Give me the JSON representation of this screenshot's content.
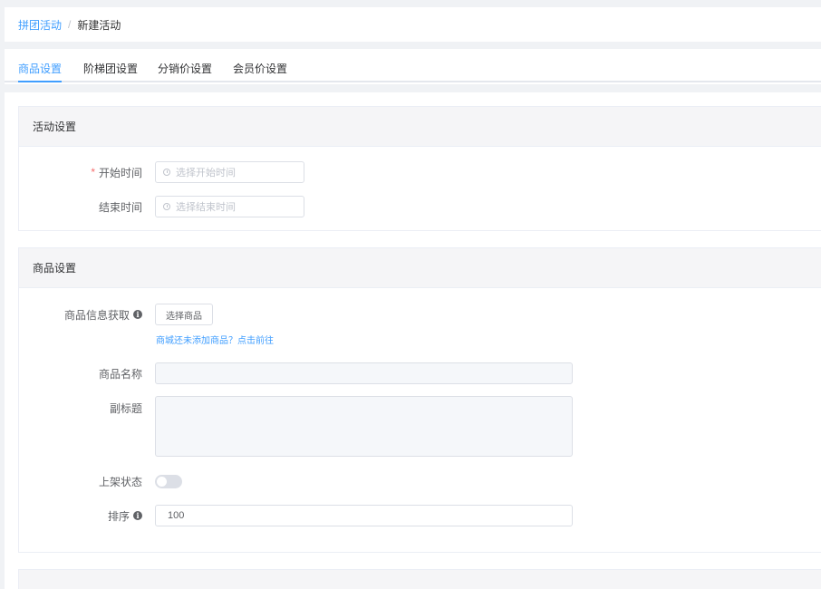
{
  "breadcrumb": {
    "parent": "拼团活动",
    "separator": "/",
    "current": "新建活动"
  },
  "tabs": [
    {
      "label": "商品设置",
      "active": true
    },
    {
      "label": "阶梯团设置",
      "active": false
    },
    {
      "label": "分销价设置",
      "active": false
    },
    {
      "label": "会员价设置",
      "active": false
    }
  ],
  "activity_card": {
    "title": "活动设置",
    "start_label": "开始时间",
    "start_required": "*",
    "start_placeholder": "选择开始时间",
    "end_label": "结束时间",
    "end_placeholder": "选择结束时间"
  },
  "product_card": {
    "title": "商品设置",
    "info_label": "商品信息获取",
    "select_button": "选择商品",
    "add_link": "商城还未添加商品？点击前往",
    "name_label": "商品名称",
    "name_value": "",
    "subtitle_label": "副标题",
    "subtitle_value": "",
    "status_label": "上架状态",
    "status_on": false,
    "sort_label": "排序",
    "sort_value": "100"
  },
  "icons": {
    "info": "info-icon",
    "clock": "clock-icon"
  },
  "colors": {
    "accent": "#409eff",
    "required": "#f56c6c",
    "background": "#f0f2f5"
  }
}
